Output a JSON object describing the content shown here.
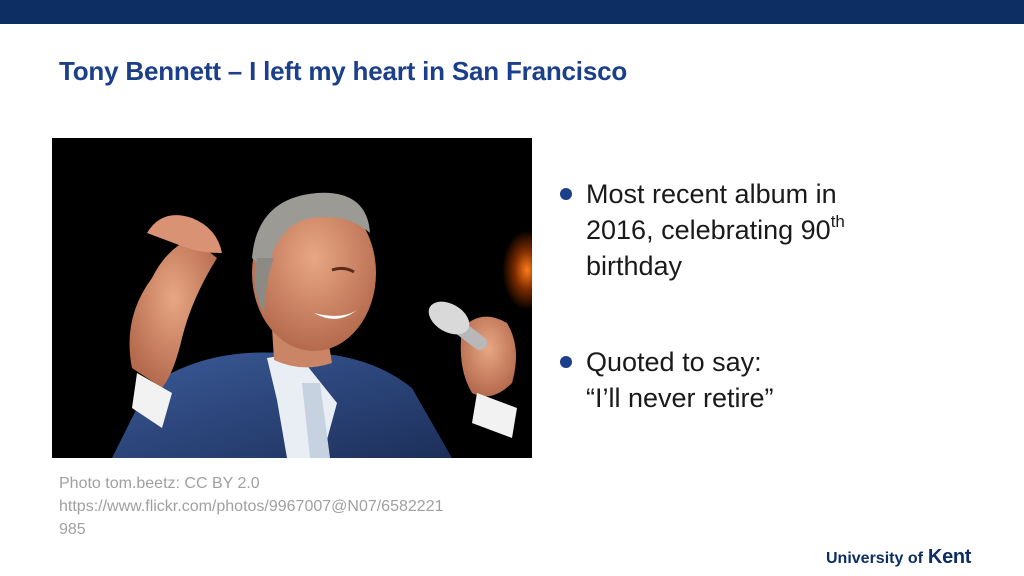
{
  "slide": {
    "title": "Tony Bennett – I left my heart in San Francisco",
    "photo": {
      "alt": "Tony Bennett singing into a microphone",
      "credit_lines": [
        "Photo tom.beetz: CC BY 2.0",
        "https://www.flickr.com/photos/9967007@N07/6582221",
        "985"
      ]
    },
    "bullets": [
      {
        "lines": [
          "Most recent album in",
          "2016, celebrating 90",
          "th",
          "birthday"
        ]
      },
      {
        "lines": [
          "Quoted to say:",
          "“I’ll never retire”"
        ]
      }
    ],
    "logo": {
      "prefix": "University of",
      "name": "Kent"
    }
  },
  "colors": {
    "top_bar": "#0d2e63",
    "title": "#1b3f8a",
    "bullet": "#1b3f8a",
    "credit": "#a0a0a0"
  }
}
